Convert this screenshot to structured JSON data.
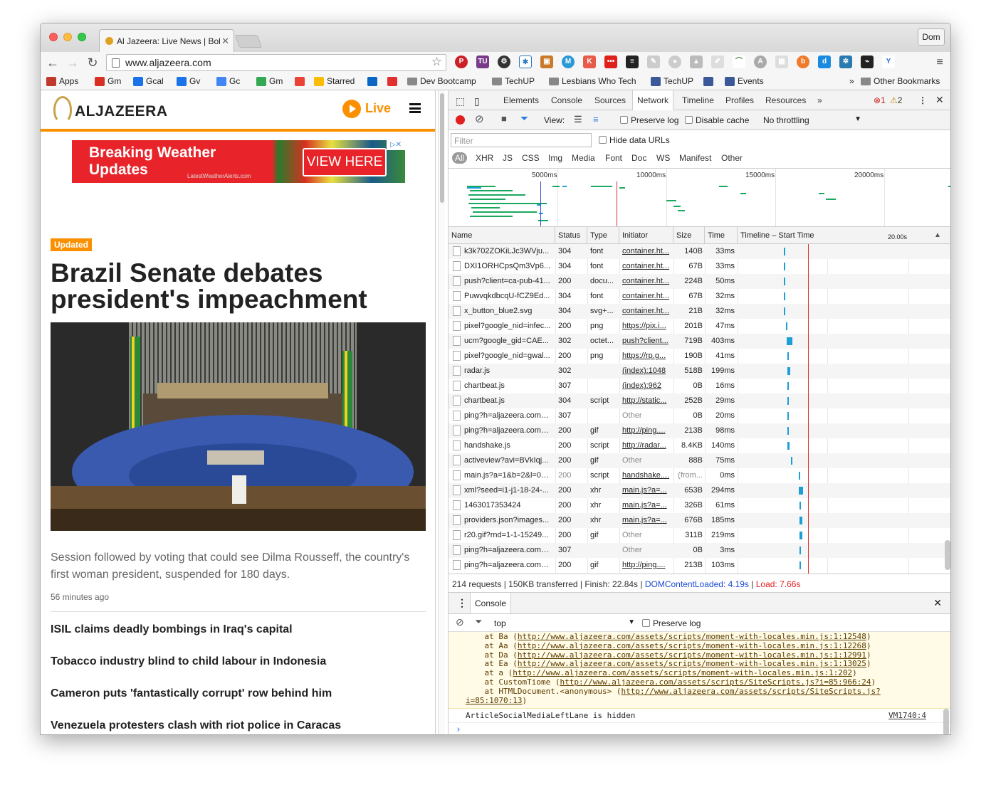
{
  "browser": {
    "tab_title": "Al Jazeera: Live News | Bol",
    "url": "www.aljazeera.com",
    "user": "Dom"
  },
  "bookmarks": [
    {
      "label": "Apps",
      "icon": "apps-grid-icon"
    },
    {
      "label": "Gm",
      "icon": "gmail-icon"
    },
    {
      "label": "Gcal",
      "icon": "calendar-icon"
    },
    {
      "label": "Gv",
      "icon": "voice-icon"
    },
    {
      "label": "Gc",
      "icon": "google-icon"
    },
    {
      "label": "Gm",
      "icon": "maps-icon"
    },
    {
      "label": "",
      "icon": "map-pin-icon"
    },
    {
      "label": "Starred",
      "icon": "drive-icon"
    },
    {
      "label": "",
      "icon": "linkedin-icon"
    },
    {
      "label": "",
      "icon": "block-icon"
    },
    {
      "label": "Dev Bootcamp",
      "icon": "folder-icon"
    },
    {
      "label": "TechUP",
      "icon": "folder-icon"
    },
    {
      "label": "Lesbians Who Tech",
      "icon": "folder-icon"
    },
    {
      "label": "TechUP",
      "icon": "facebook-icon"
    },
    {
      "label": "",
      "icon": "facebook-icon"
    },
    {
      "label": "Events",
      "icon": "facebook-icon"
    },
    {
      "label": "»",
      "icon": ""
    },
    {
      "label": "Other Bookmarks",
      "icon": "folder-icon"
    }
  ],
  "page": {
    "brand": "ALJAZEERA",
    "live_label": "Live",
    "ad": {
      "headline": "Breaking Weather Updates",
      "source": "LatestWeatherAlerts.com",
      "button": "VIEW HERE"
    },
    "badge": "Updated",
    "headline": "Brazil Senate debates president's impeachment",
    "caption": "Session followed by voting that could see Dilma Rousseff, the country's first woman president, suspended for 180 days.",
    "time_ago": "56 minutes ago",
    "stories": [
      "ISIL claims deadly bombings in Iraq's capital",
      "Tobacco industry blind to child labour in Indonesia",
      "Cameron puts 'fantastically corrupt' row behind him",
      "Venezuela protesters clash with riot police in Caracas"
    ]
  },
  "devtools": {
    "tabs": [
      "Elements",
      "Console",
      "Sources",
      "Network",
      "Timeline",
      "Profiles",
      "Resources",
      "»"
    ],
    "active_tab": "Network",
    "errors": "1",
    "warnings": "2",
    "view_label": "View:",
    "preserve_log": "Preserve log",
    "disable_cache": "Disable cache",
    "throttling": "No throttling",
    "filter_placeholder": "Filter",
    "hide_data_urls": "Hide data URLs",
    "filter_types": [
      "All",
      "XHR",
      "JS",
      "CSS",
      "Img",
      "Media",
      "Font",
      "Doc",
      "WS",
      "Manifest",
      "Other"
    ],
    "overview_ticks": [
      "5000ms",
      "10000ms",
      "15000ms",
      "20000ms"
    ],
    "columns": [
      "Name",
      "Status",
      "Type",
      "Initiator",
      "Size",
      "Time",
      "Timeline – Start Time",
      "20.00s"
    ],
    "requests": [
      {
        "name": "k3k702ZOKiLJc3WVju...",
        "status": "304",
        "type": "font",
        "initiator": "container.ht...",
        "init_link": true,
        "size": "140B",
        "time": "33ms",
        "start": 0.27
      },
      {
        "name": "DXI1ORHCpsQm3Vp6...",
        "status": "304",
        "type": "font",
        "initiator": "container.ht...",
        "init_link": true,
        "size": "67B",
        "time": "33ms",
        "start": 0.27
      },
      {
        "name": "push?client=ca-pub-41...",
        "status": "200",
        "type": "docu...",
        "initiator": "container.ht...",
        "init_link": true,
        "size": "224B",
        "time": "50ms",
        "start": 0.27
      },
      {
        "name": "PuwvqkdbcqU-fCZ9Ed...",
        "status": "304",
        "type": "font",
        "initiator": "container.ht...",
        "init_link": true,
        "size": "67B",
        "time": "32ms",
        "start": 0.27
      },
      {
        "name": "x_button_blue2.svg",
        "status": "304",
        "type": "svg+...",
        "initiator": "container.ht...",
        "init_link": true,
        "size": "21B",
        "time": "32ms",
        "start": 0.27
      },
      {
        "name": "pixel?google_nid=infec...",
        "status": "200",
        "type": "png",
        "initiator": "https://pix.i...",
        "init_link": true,
        "size": "201B",
        "time": "47ms",
        "start": 0.28
      },
      {
        "name": "ucm?google_gid=CAE...",
        "status": "302",
        "type": "octet...",
        "initiator": "push?client...",
        "init_link": true,
        "size": "719B",
        "time": "403ms",
        "start": 0.285
      },
      {
        "name": "pixel?google_nid=gwal...",
        "status": "200",
        "type": "png",
        "initiator": "https://rp.g...",
        "init_link": true,
        "size": "190B",
        "time": "41ms",
        "start": 0.29
      },
      {
        "name": "radar.js",
        "status": "302",
        "type": "",
        "initiator": "(index):1048",
        "init_link": true,
        "size": "518B",
        "time": "199ms",
        "start": 0.29
      },
      {
        "name": "chartbeat.js",
        "status": "307",
        "type": "",
        "initiator": "(index):962",
        "init_link": true,
        "size": "0B",
        "time": "16ms",
        "start": 0.29
      },
      {
        "name": "chartbeat.js",
        "status": "304",
        "type": "script",
        "initiator": "http://static...",
        "init_link": true,
        "size": "252B",
        "time": "29ms",
        "start": 0.29
      },
      {
        "name": "ping?h=aljazeera.com&...",
        "status": "307",
        "type": "",
        "initiator": "Other",
        "init_link": false,
        "size": "0B",
        "time": "20ms",
        "start": 0.29
      },
      {
        "name": "ping?h=aljazeera.com&...",
        "status": "200",
        "type": "gif",
        "initiator": "http://ping....",
        "init_link": true,
        "size": "213B",
        "time": "98ms",
        "start": 0.29
      },
      {
        "name": "handshake.js",
        "status": "200",
        "type": "script",
        "initiator": "http://radar...",
        "init_link": true,
        "size": "8.4KB",
        "time": "140ms",
        "start": 0.29
      },
      {
        "name": "activeview?avi=BVkIqj...",
        "status": "200",
        "type": "gif",
        "initiator": "Other",
        "init_link": false,
        "size": "88B",
        "time": "75ms",
        "start": 0.31
      },
      {
        "name": "main.js?a=1&b=2&l=0&...",
        "status": "200",
        "type": "script",
        "initiator": "handshake....",
        "init_link": true,
        "size": "(from...",
        "time": "0ms",
        "start": 0.355,
        "gray": true
      },
      {
        "name": "xml?seed=i1-j1-18-24-...",
        "status": "200",
        "type": "xhr",
        "initiator": "main.js?a=...",
        "init_link": true,
        "size": "653B",
        "time": "294ms",
        "start": 0.355
      },
      {
        "name": "1463017353424",
        "status": "200",
        "type": "xhr",
        "initiator": "main.js?a=...",
        "init_link": true,
        "size": "326B",
        "time": "61ms",
        "start": 0.36
      },
      {
        "name": "providers.json?images...",
        "status": "200",
        "type": "xhr",
        "initiator": "main.js?a=...",
        "init_link": true,
        "size": "676B",
        "time": "185ms",
        "start": 0.36
      },
      {
        "name": "r20.gif?rnd=1-1-15249...",
        "status": "200",
        "type": "gif",
        "initiator": "Other",
        "init_link": false,
        "size": "311B",
        "time": "219ms",
        "start": 0.36
      },
      {
        "name": "ping?h=aljazeera.com&...",
        "status": "307",
        "type": "",
        "initiator": "Other",
        "init_link": false,
        "size": "0B",
        "time": "3ms",
        "start": 0.36
      },
      {
        "name": "ping?h=aljazeera.com&...",
        "status": "200",
        "type": "gif",
        "initiator": "http://ping....",
        "init_link": true,
        "size": "213B",
        "time": "103ms",
        "start": 0.36
      }
    ],
    "summary": {
      "main": "214 requests | 150KB transferred | Finish: 22.84s | ",
      "dom": "DOMContentLoaded: 4.19s",
      "sep": " | ",
      "load": "Load: 7.66s"
    },
    "console": {
      "tab": "Console",
      "context": "top",
      "preserve_log": "Preserve log",
      "stack": [
        {
          "prefix": "    at Ba (",
          "link": "http://www.aljazeera.com/assets/scripts/moment-with-locales.min.js:1:12548",
          "suffix": ")"
        },
        {
          "prefix": "    at Aa (",
          "link": "http://www.aljazeera.com/assets/scripts/moment-with-locales.min.js:1:12268",
          "suffix": ")"
        },
        {
          "prefix": "    at Da (",
          "link": "http://www.aljazeera.com/assets/scripts/moment-with-locales.min.js:1:12991",
          "suffix": ")"
        },
        {
          "prefix": "    at Ea (",
          "link": "http://www.aljazeera.com/assets/scripts/moment-with-locales.min.js:1:13025",
          "suffix": ")"
        },
        {
          "prefix": "    at a (",
          "link": "http://www.aljazeera.com/assets/scripts/moment-with-locales.min.js:1:202",
          "suffix": ")"
        },
        {
          "prefix": "    at CustomTiome (",
          "link": "http://www.aljazeera.com/assets/scripts/SiteScripts.js?i=85:966:24",
          "suffix": ")"
        },
        {
          "prefix": "    at HTMLDocument.<anonymous> (",
          "link": "http://www.aljazeera.com/assets/scripts/SiteScripts.js?",
          "suffix": ""
        },
        {
          "prefix": "",
          "link": "i=85:1070:13",
          "suffix": ")"
        }
      ],
      "info": "ArticleSocialMediaLeftLane is hidden",
      "info_src": "VM1740:4",
      "prompt": "›"
    }
  },
  "colors": {
    "accent": "#fa9000",
    "network_active": "#1c9ed6",
    "error_red": "#e03030",
    "dom_blue": "#1a4ad6"
  }
}
